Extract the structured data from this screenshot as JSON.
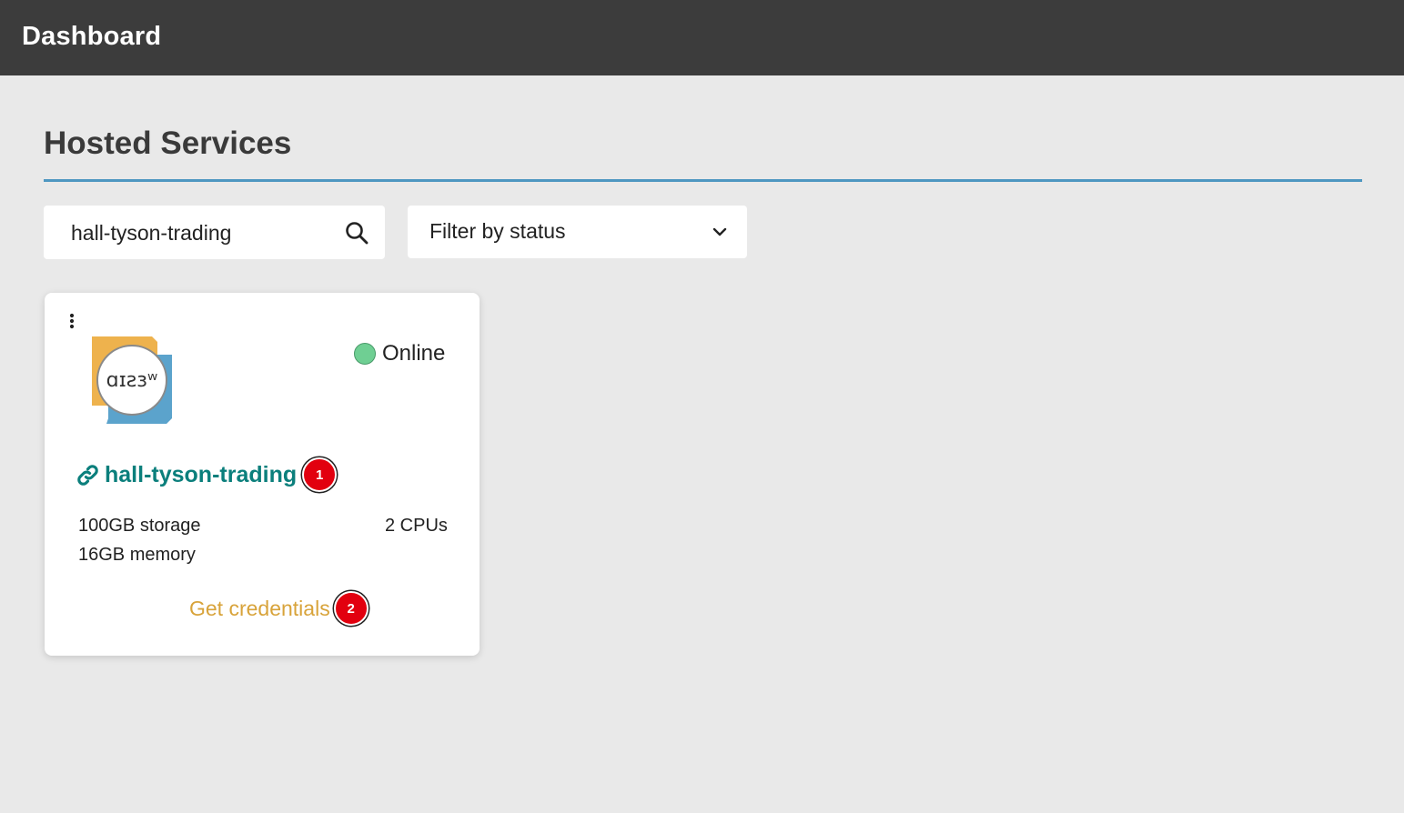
{
  "header": {
    "title": "Dashboard"
  },
  "page": {
    "title": "Hosted Services"
  },
  "search": {
    "value": "hall-tyson-trading",
    "icon": "search-icon"
  },
  "filter": {
    "label": "Filter by status",
    "icon": "chevron-down-icon"
  },
  "card": {
    "menu_icon": "kebab-menu-icon",
    "status": {
      "label": "Online",
      "color": "#6fcf93"
    },
    "service": {
      "name": "hall-tyson-trading",
      "icon": "link-icon",
      "color": "#0b7f7c"
    },
    "specs": {
      "storage": "100GB storage",
      "memory": "16GB memory",
      "cpus": "2 CPUs"
    },
    "credentials": {
      "label": "Get credentials",
      "color": "#d8a33a"
    }
  },
  "badges": [
    "1",
    "2"
  ],
  "colors": {
    "topbar": "#3c3c3c",
    "accent_rule": "#4e97c1",
    "background": "#e9e9e9",
    "badge": "#e2000f"
  }
}
